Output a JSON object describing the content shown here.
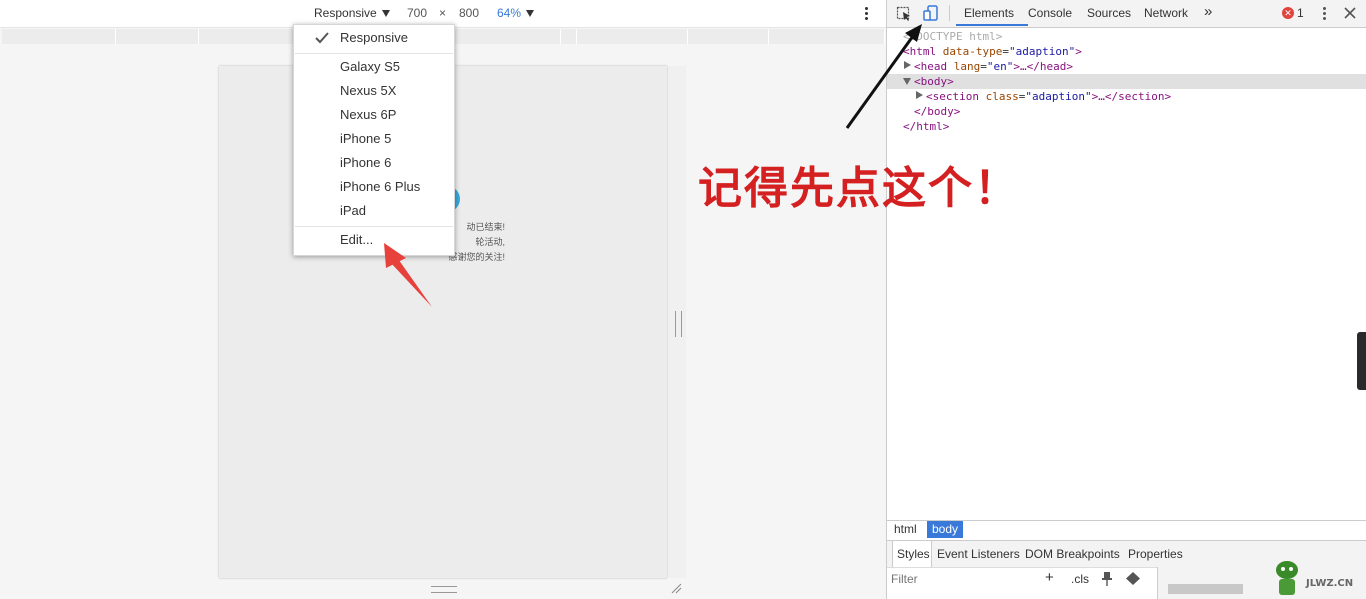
{
  "device_toolbar": {
    "device_select": "Responsive",
    "width": "700",
    "times": "×",
    "height": "800",
    "zoom": "64%"
  },
  "device_menu": {
    "items": [
      {
        "label": "Responsive",
        "checked": true
      },
      {
        "label": "Galaxy S5"
      },
      {
        "label": "Nexus 5X"
      },
      {
        "label": "Nexus 6P"
      },
      {
        "label": "iPhone 5"
      },
      {
        "label": "iPhone 6"
      },
      {
        "label": "iPhone 6 Plus"
      },
      {
        "label": "iPad"
      },
      {
        "label": "Edit..."
      }
    ]
  },
  "page_preview": {
    "lines": [
      "动已结束!",
      "轮活动,",
      "感谢您的关注!"
    ]
  },
  "devtools": {
    "tabs": [
      "Elements",
      "Console",
      "Sources",
      "Network"
    ],
    "more_tabs": "»",
    "error_count": "1",
    "dom": {
      "doctype": "<!DOCTYPE html>",
      "html_open_tag": "<html",
      "html_attr": "data-type",
      "html_val": "\"adaption\"",
      "html_close": ">",
      "head_tag": "<head",
      "head_attr": "lang",
      "head_val": "\"en\"",
      "head_rest": ">…</head>",
      "body_open": "<body>",
      "section_tag": "<section",
      "section_attr": "class",
      "section_val": "\"adaption\"",
      "section_rest": ">…</section>",
      "body_close": "</body>",
      "html_end": "</html>"
    },
    "breadcrumbs": [
      "html",
      "body"
    ],
    "styles_tabs": [
      "Styles",
      "Event Listeners",
      "DOM Breakpoints",
      "Properties"
    ],
    "filter_placeholder": "Filter",
    "cls_label": ".cls",
    "plus_label": "+"
  },
  "annotation": {
    "text": "记得先点这个！",
    "color": "#d42020"
  },
  "watermark": {
    "text": "JLWZ.CN"
  },
  "colors": {
    "accent": "#3879d9",
    "error": "#e0443e",
    "arrow_red": "#e8413c"
  }
}
